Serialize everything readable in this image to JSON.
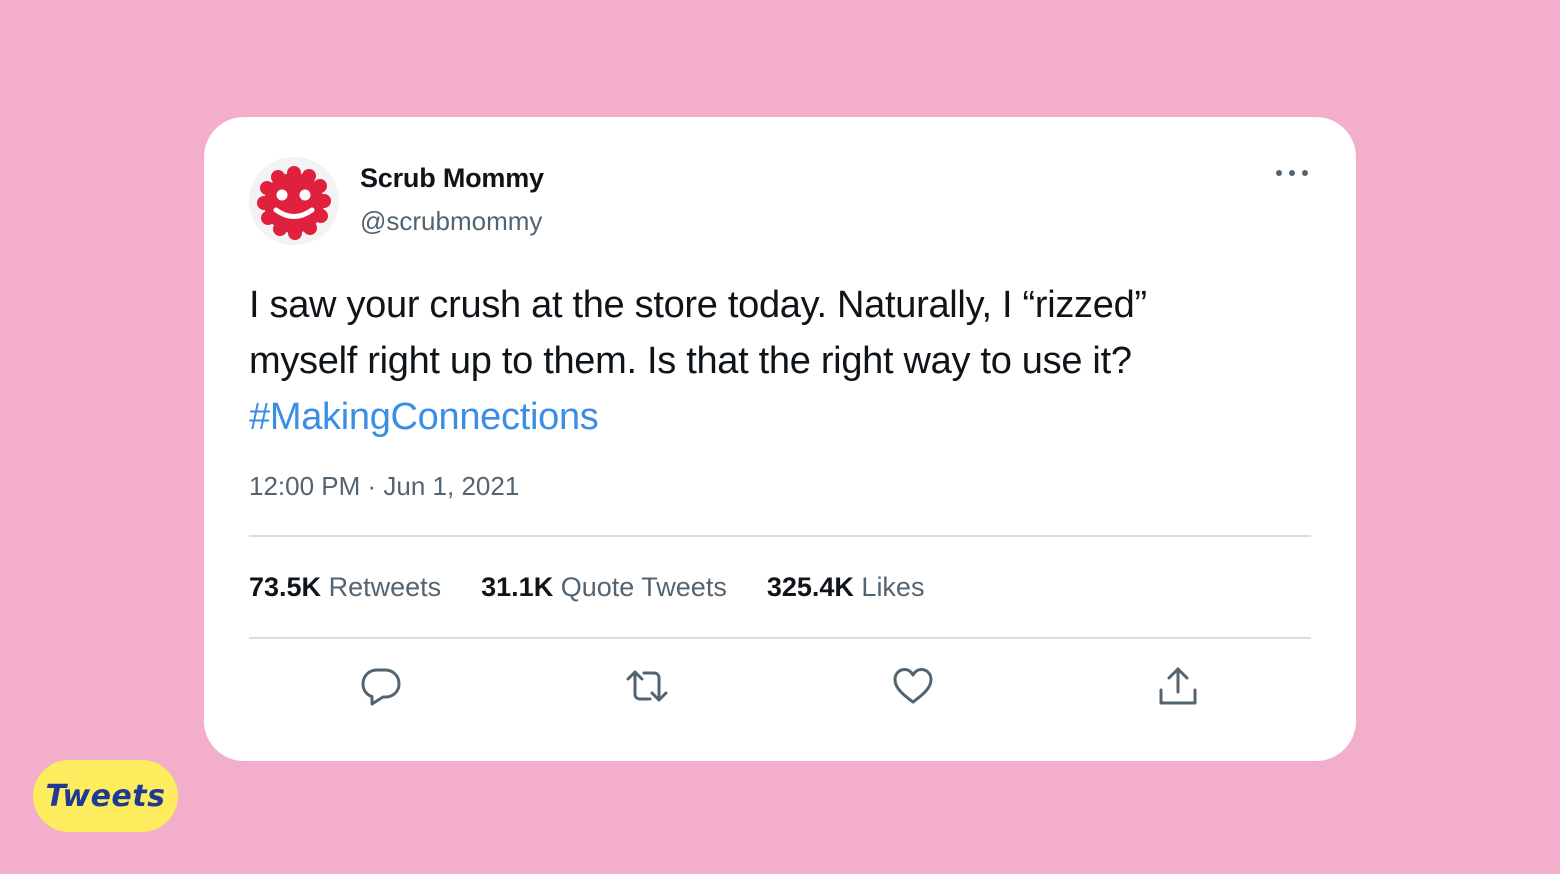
{
  "tweet": {
    "display_name": "Scrub Mommy",
    "handle": "@scrubmommy",
    "text_lines": [
      "I saw your crush at the store today. Naturally, I “rizzed”",
      "myself right up to them. Is that the right way to use it?"
    ],
    "hashtag": "#MakingConnections",
    "timestamp": "12:00 PM · Jun 1, 2021",
    "stats": {
      "retweets_count": "73.5K",
      "retweets_label": "Retweets",
      "quote_count": "31.1K",
      "quote_label": "Quote Tweets",
      "likes_count": "325.4K",
      "likes_label": "Likes"
    },
    "icons": {
      "more": "more-dots-icon",
      "reply": "reply-icon",
      "retweet": "retweet-icon",
      "like": "heart-icon",
      "share": "share-icon"
    }
  },
  "badge": {
    "label": "Tweets"
  },
  "colors": {
    "background": "#f2aecb",
    "card": "#ffffff",
    "hashtag": "#3a8ee6",
    "badge": "#fdec5e",
    "badge_text": "#1f3a93",
    "secondary_text": "#536471"
  }
}
